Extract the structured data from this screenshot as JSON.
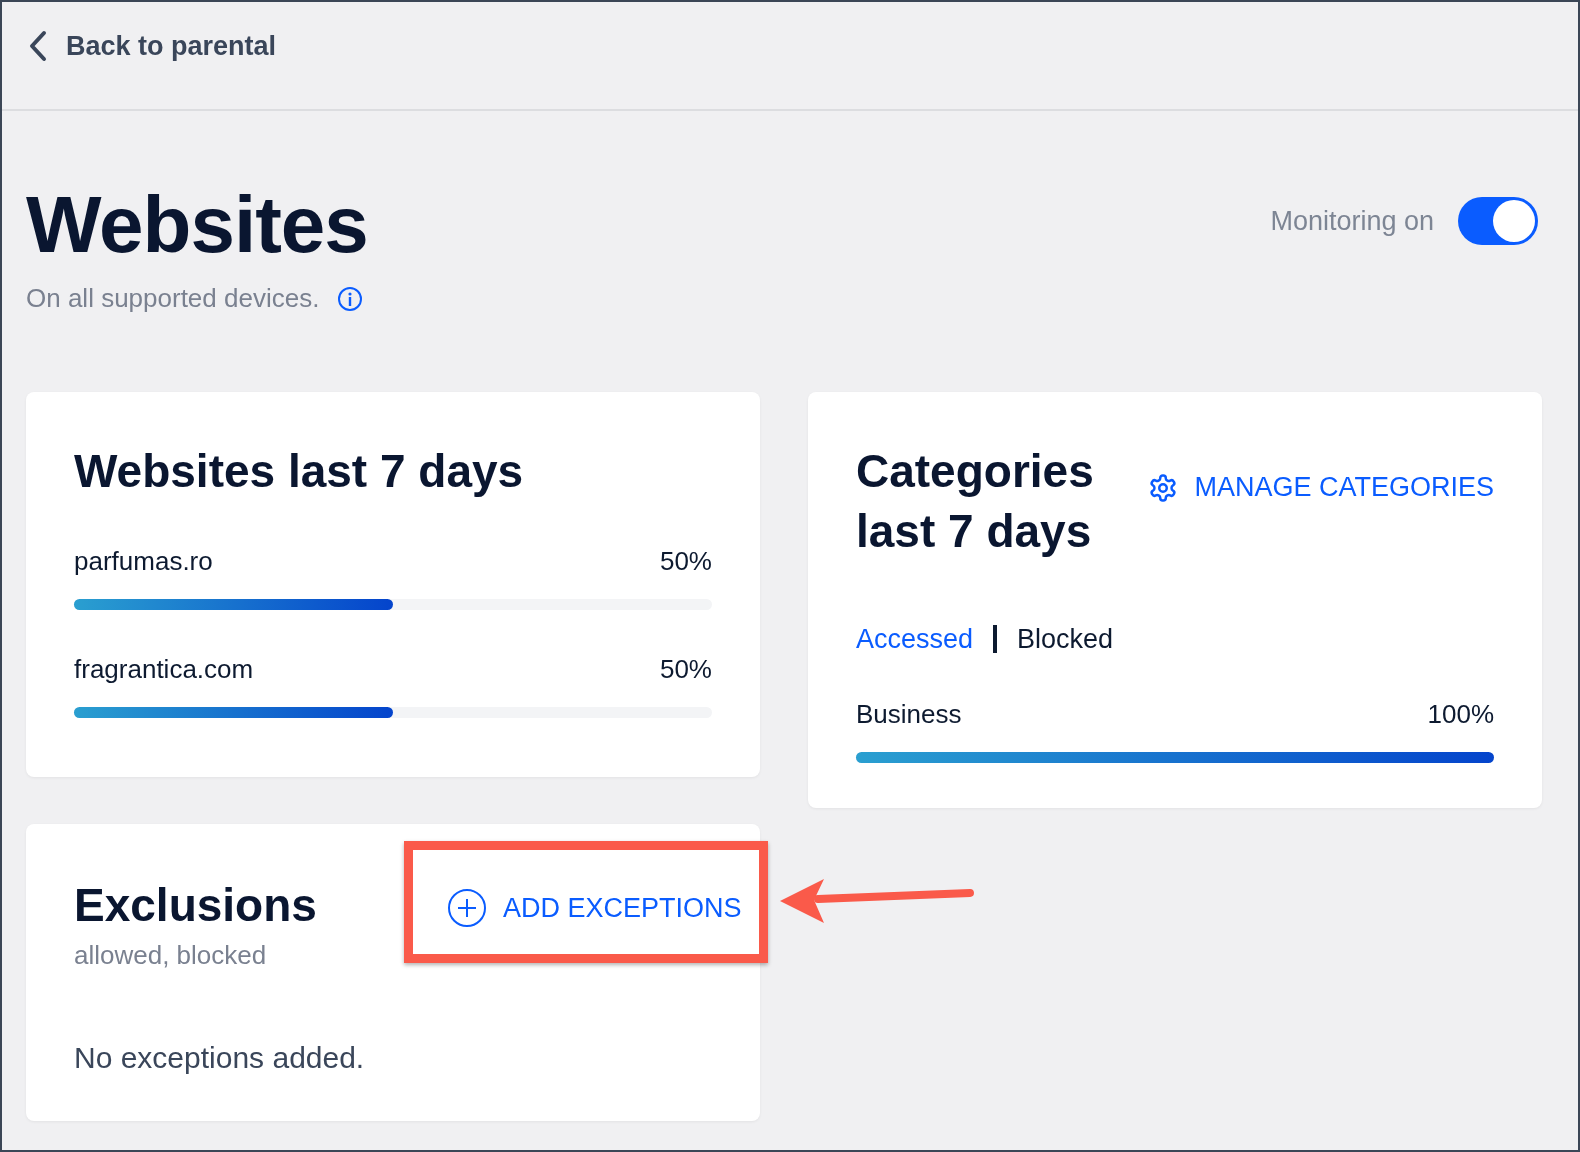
{
  "header": {
    "back_link": "Back to parental"
  },
  "page": {
    "title": "Websites",
    "subtitle": "On all supported devices.",
    "monitoring": {
      "label": "Monitoring on",
      "on": true
    }
  },
  "websites_card": {
    "title": "Websites last 7 days",
    "items": [
      {
        "name": "parfumas.ro",
        "percent": "50%",
        "level": 0.5
      },
      {
        "name": "fragrantica.com",
        "percent": "50%",
        "level": 0.5
      }
    ]
  },
  "categories_card": {
    "title": "Categories last 7 days",
    "manage_button": "MANAGE CATEGORIES",
    "tabs": [
      {
        "label": "Accessed",
        "selected": true
      },
      {
        "label": "Blocked",
        "selected": false
      }
    ],
    "items": [
      {
        "name": "Business",
        "percent": "100%",
        "level": 1
      }
    ]
  },
  "exclusions_card": {
    "title": "Exclusions",
    "subtitle": "allowed, blocked",
    "add_button": "ADD EXCEPTIONS",
    "empty_message": "No exceptions added."
  }
}
